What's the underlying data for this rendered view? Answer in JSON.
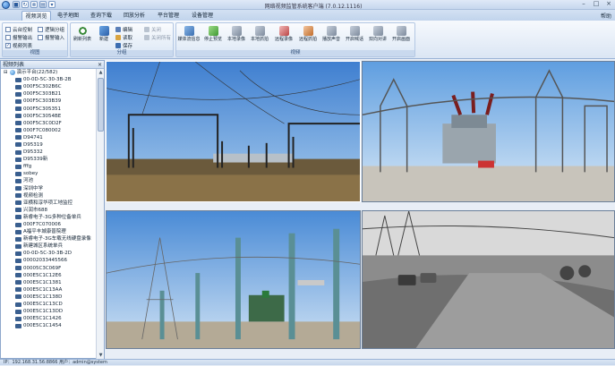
{
  "app": {
    "title": "网络视频监管系统客户端 (7.0.12.1116)"
  },
  "titlebar_buttons": [
    "minimize",
    "maximize",
    "close"
  ],
  "tabs": [
    {
      "label": "视频浏览",
      "active": true
    },
    {
      "label": "电子地图",
      "active": false
    },
    {
      "label": "查询下载",
      "active": false
    },
    {
      "label": "回放分析",
      "active": false
    },
    {
      "label": "平台管理",
      "active": false
    },
    {
      "label": "设备管理",
      "active": false
    }
  ],
  "help": "帮助",
  "ribbon": {
    "view_group": {
      "label": "视图",
      "checks": [
        {
          "label": "云台控制",
          "checked": false
        },
        {
          "label": "报警输出",
          "checked": false
        },
        {
          "label": "视频列表",
          "checked": true
        },
        {
          "label": "逻辑分组",
          "checked": false
        },
        {
          "label": "报警输入",
          "checked": false
        }
      ]
    },
    "group_group": {
      "label": "分组",
      "big": [
        {
          "label": "刷新列表"
        },
        {
          "label": "新建"
        }
      ],
      "small": [
        {
          "label": "编辑",
          "disabled": false
        },
        {
          "label": "读取",
          "disabled": false
        },
        {
          "label": "保存",
          "disabled": false
        },
        {
          "label": "关闭",
          "disabled": true
        },
        {
          "label": "关闭所有",
          "disabled": true
        }
      ]
    },
    "video_group": {
      "label": "视频",
      "buttons": [
        {
          "label": "媒体流信息"
        },
        {
          "label": "停止预览"
        },
        {
          "label": "本地录像"
        },
        {
          "label": "本地抓拍"
        },
        {
          "label": "远程录像"
        },
        {
          "label": "远程抓拍"
        },
        {
          "label": "播放声音"
        },
        {
          "label": "开启喊话"
        },
        {
          "label": "双向对讲"
        },
        {
          "label": "开启画面"
        }
      ]
    }
  },
  "device_panel": {
    "title": "视频列表",
    "root": "演示平台(22/582)",
    "items": [
      "00-0D-5C-30-3B-2B",
      "000F5C302B6C",
      "000F5C303B21",
      "000F5C303B39",
      "000F5C305351",
      "000F5C3054BE",
      "000F5C3C0D2F",
      "000F7C080002",
      "D94741",
      "D95319",
      "D95332",
      "D95339新",
      "fffg",
      "sobey",
      "河池",
      "深圳中学",
      "视频检测",
      "亚横和淳华项工地监控",
      "兴润市688",
      "新睿电子-3G多种位备单兵",
      "000F7C070006",
      "A福平丰城康普院理",
      "新睿电子-3G车载无线硬盘录像",
      "新建城区系统单兵",
      "00-0D-5C-30-3B-2D",
      "00002033445566",
      "00005C3C069F",
      "000E5C1C12E6",
      "000E5C1C1381",
      "000E5C1C13AA",
      "000E5C1C138D",
      "000E5C1C13CD",
      "000E5C1C13DD",
      "000E5C1C1426",
      "000E5C1C1454"
    ]
  },
  "statusbar": {
    "text": "IP：192.168.31.56:8866    用户：admin@system"
  }
}
